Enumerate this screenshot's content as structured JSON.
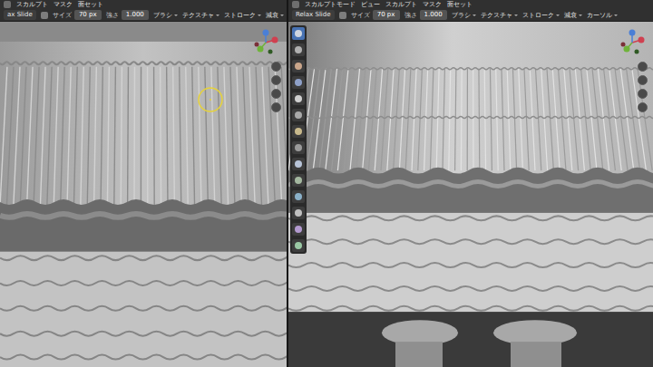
{
  "panels": [
    {
      "side": "left",
      "menu": [
        "スカルプト",
        "マスク",
        "面セット"
      ],
      "tool": "ax Slide",
      "settings": [
        {
          "label": "サイズ",
          "value": "70 px"
        },
        {
          "label": "強さ",
          "value": "1.000"
        }
      ],
      "options": [
        "ブラシ",
        "テクスチャ",
        "ストローク",
        "減衰"
      ],
      "show_toolbar": false,
      "show_brush_cursor": true
    },
    {
      "side": "right",
      "menu": [
        "スカルプトモード",
        "ビュー",
        "スカルプト",
        "マスク",
        "面セット"
      ],
      "tool": "Relax Slide",
      "settings": [
        {
          "label": "サイズ",
          "value": "70 px"
        },
        {
          "label": "強さ",
          "value": "1.000"
        }
      ],
      "options": [
        "ブラシ",
        "テクスチャ",
        "ストローク",
        "減衰",
        "カーソル"
      ],
      "show_toolbar": true,
      "show_brush_cursor": false
    }
  ],
  "tools": [
    {
      "selected": true
    },
    {
      "selected": false
    },
    {
      "selected": false
    },
    {
      "selected": false
    },
    {
      "selected": false
    },
    {
      "selected": false
    },
    {
      "selected": false
    },
    {
      "selected": false
    },
    {
      "selected": false
    },
    {
      "selected": false
    },
    {
      "selected": false
    },
    {
      "selected": false
    },
    {
      "selected": false
    },
    {
      "selected": false
    },
    {
      "selected": false
    },
    {
      "selected": false
    },
    {
      "selected": false
    },
    {
      "selected": false
    }
  ]
}
